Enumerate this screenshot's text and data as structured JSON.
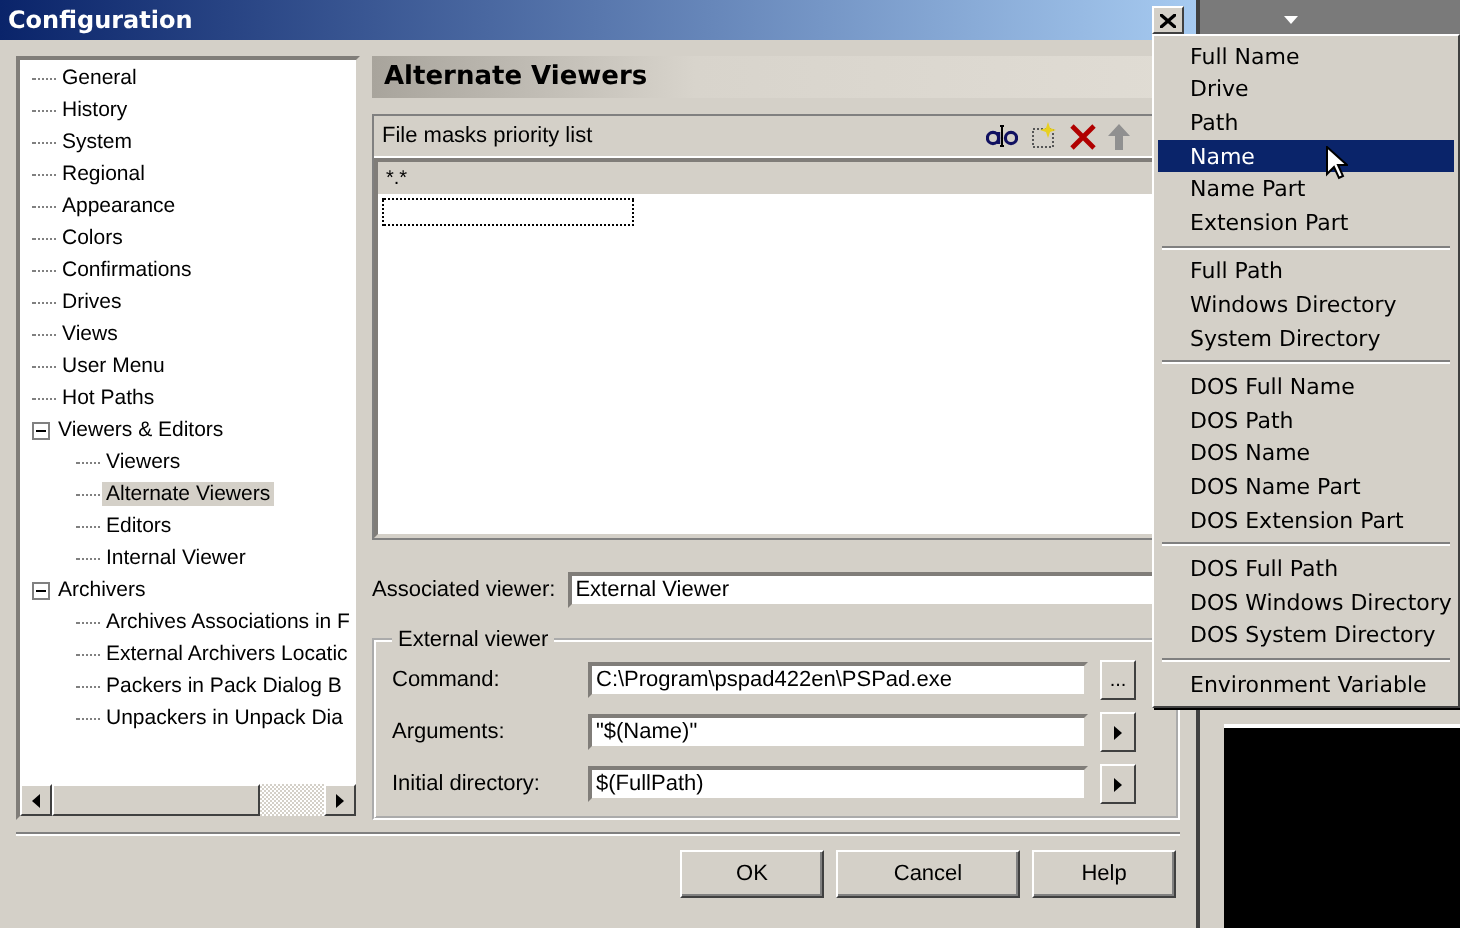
{
  "window": {
    "title": "Configuration"
  },
  "tree": [
    {
      "label": "General",
      "selected": false
    },
    {
      "label": "History",
      "selected": false
    },
    {
      "label": "System",
      "selected": false
    },
    {
      "label": "Regional",
      "selected": false
    },
    {
      "label": "Appearance",
      "selected": false
    },
    {
      "label": "Colors",
      "selected": false
    },
    {
      "label": "Confirmations",
      "selected": false
    },
    {
      "label": "Drives",
      "selected": false
    },
    {
      "label": "Views",
      "selected": false
    },
    {
      "label": "User Menu",
      "selected": false
    },
    {
      "label": "Hot Paths",
      "selected": false
    },
    {
      "label": "Viewers & Editors",
      "selected": false,
      "expanded": true,
      "children": [
        {
          "label": "Viewers",
          "selected": false
        },
        {
          "label": "Alternate Viewers",
          "selected": true
        },
        {
          "label": "Editors",
          "selected": false
        },
        {
          "label": "Internal Viewer",
          "selected": false
        }
      ]
    },
    {
      "label": "Archivers",
      "selected": false,
      "expanded": true,
      "children": [
        {
          "label": "Archives Associations in F",
          "selected": false
        },
        {
          "label": "External Archivers Locatic",
          "selected": false
        },
        {
          "label": "Packers in Pack Dialog B",
          "selected": false
        },
        {
          "label": "Unpackers in Unpack Dia",
          "selected": false
        }
      ]
    }
  ],
  "page": {
    "title": "Alternate Viewers",
    "list": {
      "title": "File masks priority list",
      "items": [
        {
          "text": "*.*",
          "selected": true
        }
      ],
      "editing": true
    },
    "associated_viewer": {
      "label": "Associated viewer:",
      "value": "External Viewer"
    },
    "group": {
      "title": "External viewer",
      "fields": [
        {
          "label": "Command:",
          "value": "C:\\Program\\pspad422en\\PSPad.exe",
          "button": "..."
        },
        {
          "label": "Arguments:",
          "value": "\"$(Name)\"",
          "menu_button": true
        },
        {
          "label": "Initial directory:",
          "value": "$(FullPath)",
          "menu_button": true
        }
      ]
    }
  },
  "buttons": [
    "OK",
    "Cancel",
    "Help"
  ],
  "menu": {
    "groups": [
      [
        {
          "label": "Full Name",
          "selected": false
        },
        {
          "label": "Drive",
          "selected": false
        },
        {
          "label": "Path",
          "selected": false
        },
        {
          "label": "Name",
          "selected": true
        },
        {
          "label": "Name Part",
          "selected": false
        },
        {
          "label": "Extension Part",
          "selected": false
        }
      ],
      [
        {
          "label": "Full Path",
          "selected": false
        },
        {
          "label": "Windows Directory",
          "selected": false
        },
        {
          "label": "System Directory",
          "selected": false
        }
      ],
      [
        {
          "label": "DOS Full Name",
          "selected": false
        },
        {
          "label": "DOS Path",
          "selected": false
        },
        {
          "label": "DOS Name",
          "selected": false
        },
        {
          "label": "DOS Name Part",
          "selected": false
        },
        {
          "label": "DOS Extension Part",
          "selected": false
        }
      ],
      [
        {
          "label": "DOS Full Path",
          "selected": false
        },
        {
          "label": "DOS Windows Directory",
          "selected": false
        },
        {
          "label": "DOS System Directory",
          "selected": false
        }
      ],
      [
        {
          "label": "Environment Variable",
          "selected": false
        }
      ]
    ]
  }
}
